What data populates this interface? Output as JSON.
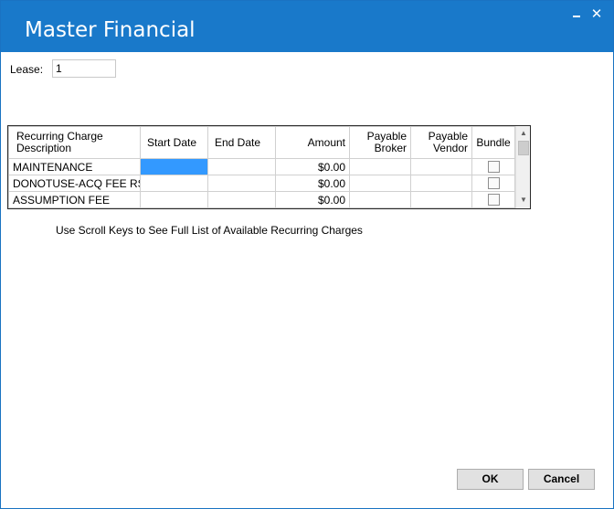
{
  "window": {
    "title": "Master Financial",
    "minimize_glyph": "_",
    "close_glyph": "✕"
  },
  "lease": {
    "label": "Lease:",
    "value": "1"
  },
  "grid": {
    "columns": [
      {
        "line1": "Recurring Charge",
        "line2": "Description"
      },
      {
        "line1": "Start Date",
        "line2": ""
      },
      {
        "line1": "End Date",
        "line2": ""
      },
      {
        "line1": "Amount",
        "line2": ""
      },
      {
        "line1": "Payable",
        "line2": "Broker"
      },
      {
        "line1": "Payable",
        "line2": "Vendor"
      },
      {
        "line1": "Bundle",
        "line2": ""
      }
    ],
    "rows": [
      {
        "description": "MAINTENANCE",
        "start_date": "",
        "end_date": "",
        "amount": "$0.00",
        "broker": "",
        "vendor": "",
        "bundle": false
      },
      {
        "description": "DONOTUSE-ACQ FEE RSV",
        "start_date": "",
        "end_date": "",
        "amount": "$0.00",
        "broker": "",
        "vendor": "",
        "bundle": false
      },
      {
        "description": "ASSUMPTION FEE",
        "start_date": "",
        "end_date": "",
        "amount": "$0.00",
        "broker": "",
        "vendor": "",
        "bundle": false
      }
    ],
    "scroll_up_glyph": "▲",
    "scroll_down_glyph": "▼"
  },
  "hint": "Use Scroll Keys to See Full List of Available Recurring Charges",
  "buttons": {
    "ok": "OK",
    "cancel": "Cancel"
  },
  "colors": {
    "titlebar": "#1979ca",
    "selection": "#3399ff"
  }
}
